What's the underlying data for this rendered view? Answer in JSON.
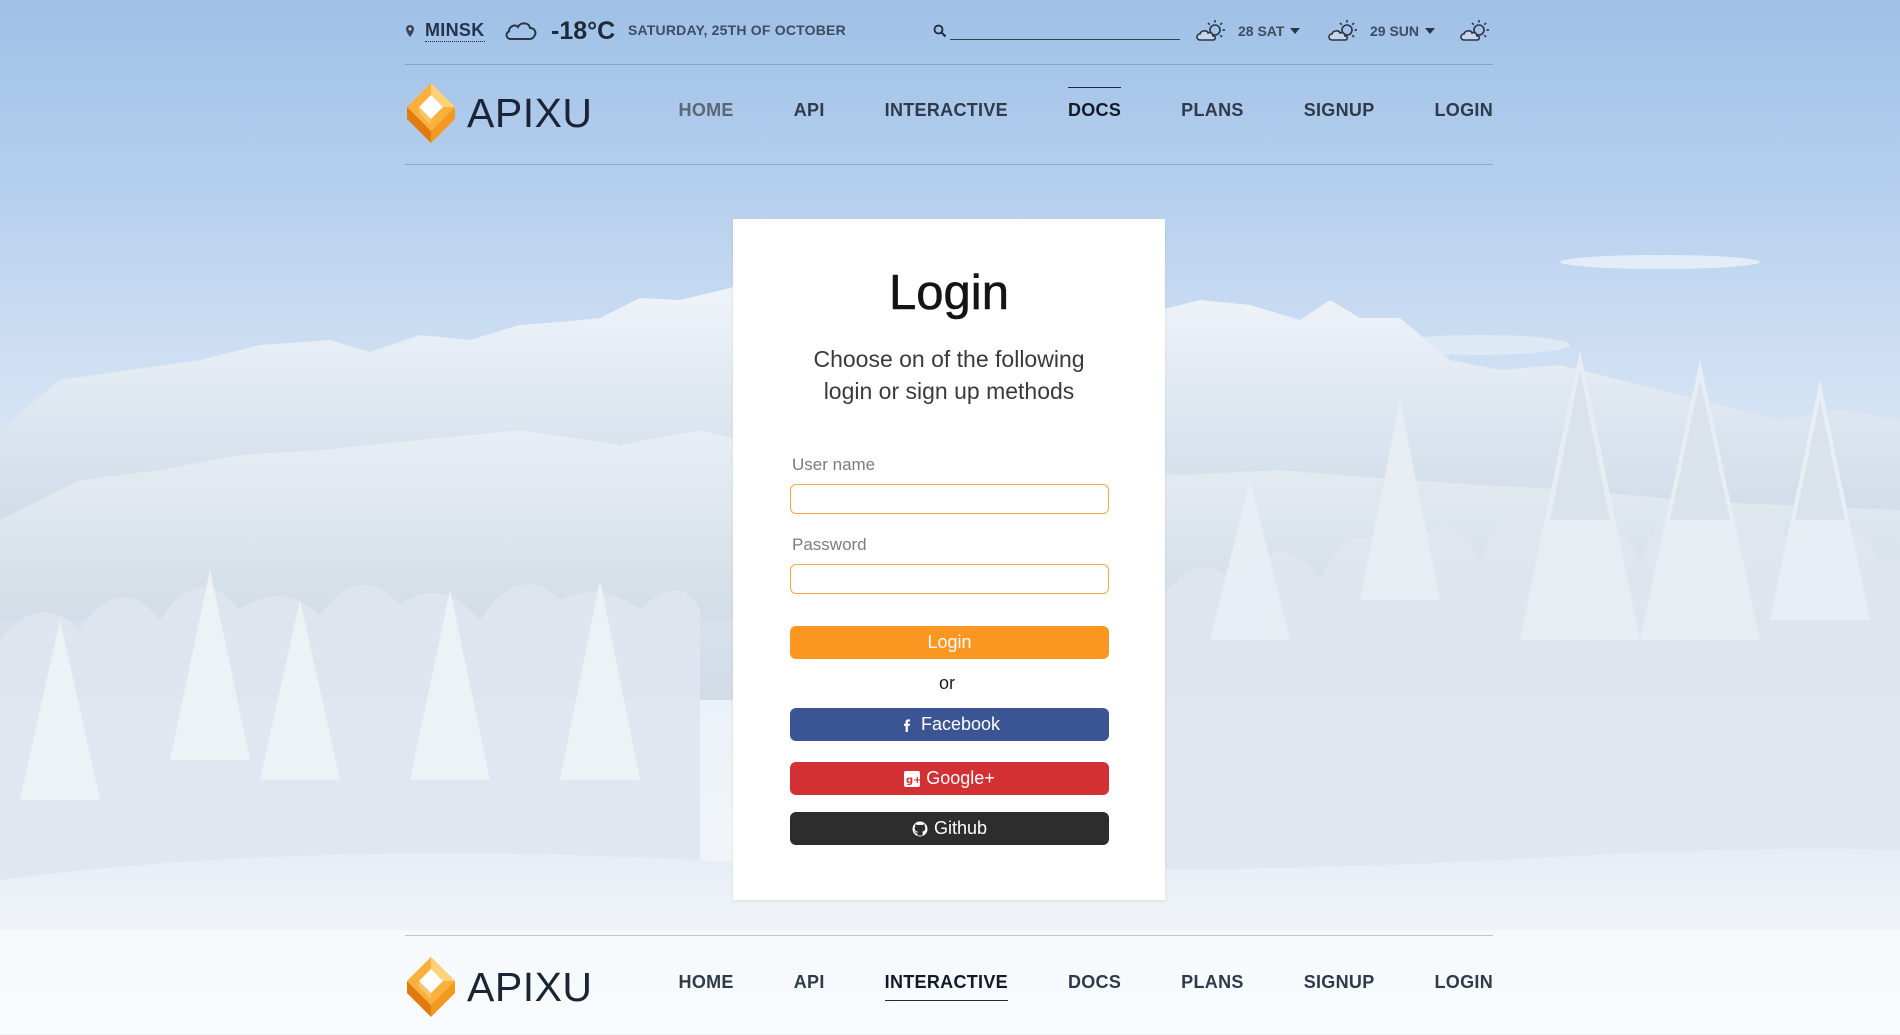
{
  "topbar": {
    "location": "MINSK",
    "current_temp": "-18°C",
    "date": "SATURDAY, 25TH OF OCTOBER",
    "search_placeholder": "",
    "forecast": [
      {
        "label": "28 SAT",
        "icon": "sun-cloud-icon"
      },
      {
        "label": "29 SUN",
        "icon": "sun-cloud-icon"
      },
      {
        "label": "",
        "icon": "sun-cloud-icon"
      }
    ],
    "current_icon": "cloud-icon"
  },
  "header": {
    "logo_text": "APIXU",
    "menu": [
      "HOME",
      "API",
      "INTERACTIVE",
      "DOCS",
      "PLANS",
      "SIGNUP",
      "LOGIN"
    ],
    "active": "DOCS"
  },
  "login": {
    "title": "Login",
    "subtitle": "Choose on of the following login or sign up methods",
    "username_label": "User name",
    "password_label": "Password",
    "login_button": "Login",
    "or_text": "or",
    "facebook_button": "Facebook",
    "google_button": "Google+",
    "github_button": "Github"
  },
  "footer": {
    "logo_text": "APIXU",
    "menu": [
      "HOME",
      "API",
      "INTERACTIVE",
      "DOCS",
      "PLANS",
      "SIGNUP",
      "LOGIN"
    ],
    "active": "INTERACTIVE"
  },
  "colors": {
    "accent_orange": "#fb9620",
    "facebook": "#3b5594",
    "google": "#d33033",
    "github": "#2d2d2d",
    "input_border": "#f4a945"
  }
}
